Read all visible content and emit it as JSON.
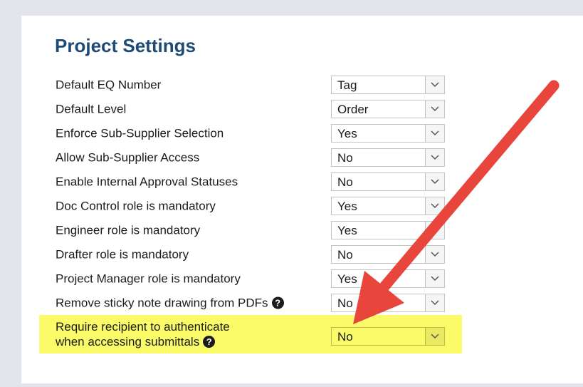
{
  "page": {
    "title": "Project Settings"
  },
  "settings": [
    {
      "label": "Default EQ Number",
      "value": "Tag"
    },
    {
      "label": "Default Level",
      "value": "Order"
    },
    {
      "label": "Enforce Sub-Supplier Selection",
      "value": "Yes"
    },
    {
      "label": "Allow Sub-Supplier Access",
      "value": "No"
    },
    {
      "label": "Enable Internal Approval Statuses",
      "value": "No"
    },
    {
      "label": "Doc Control role is mandatory",
      "value": "Yes"
    },
    {
      "label": "Engineer role is mandatory",
      "value": "Yes"
    },
    {
      "label": "Drafter role is mandatory",
      "value": "No"
    },
    {
      "label": "Project Manager role is mandatory",
      "value": "Yes"
    },
    {
      "label": "Remove sticky note drawing from PDFs",
      "value": "No"
    },
    {
      "label_line1": "Require recipient to authenticate",
      "label_line2": "when accessing submittals",
      "value": "No"
    }
  ],
  "icons": {
    "help": "question-circle-icon",
    "dropdown": "chevron-down-icon"
  },
  "colors": {
    "title": "#1e4a78",
    "highlight": "#fbfb6a",
    "arrow": "#e8453c"
  }
}
